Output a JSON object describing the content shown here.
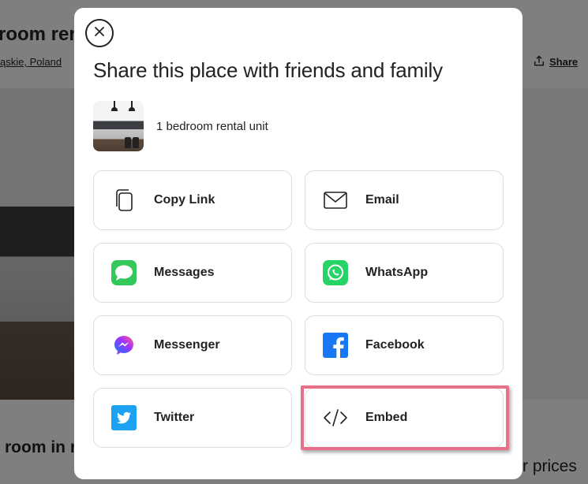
{
  "background": {
    "title": "room ren",
    "location": "ąskie, Poland",
    "share_label": "Share",
    "room_heading": "room in r",
    "prices_text": "r prices"
  },
  "modal": {
    "title": "Share this place with friends and family",
    "listing_name": "1 bedroom rental unit",
    "options": [
      {
        "label": "Copy Link",
        "icon": "copy-icon"
      },
      {
        "label": "Email",
        "icon": "envelope-icon"
      },
      {
        "label": "Messages",
        "icon": "messages-icon"
      },
      {
        "label": "WhatsApp",
        "icon": "whatsapp-icon"
      },
      {
        "label": "Messenger",
        "icon": "messenger-icon"
      },
      {
        "label": "Facebook",
        "icon": "facebook-icon"
      },
      {
        "label": "Twitter",
        "icon": "twitter-icon"
      },
      {
        "label": "Embed",
        "icon": "code-icon"
      }
    ]
  },
  "colors": {
    "highlight": "#e8718a",
    "messages_green": "#34c759",
    "whatsapp_green": "#25d366",
    "facebook_blue": "#1877f2",
    "twitter_blue": "#1da1f2"
  }
}
